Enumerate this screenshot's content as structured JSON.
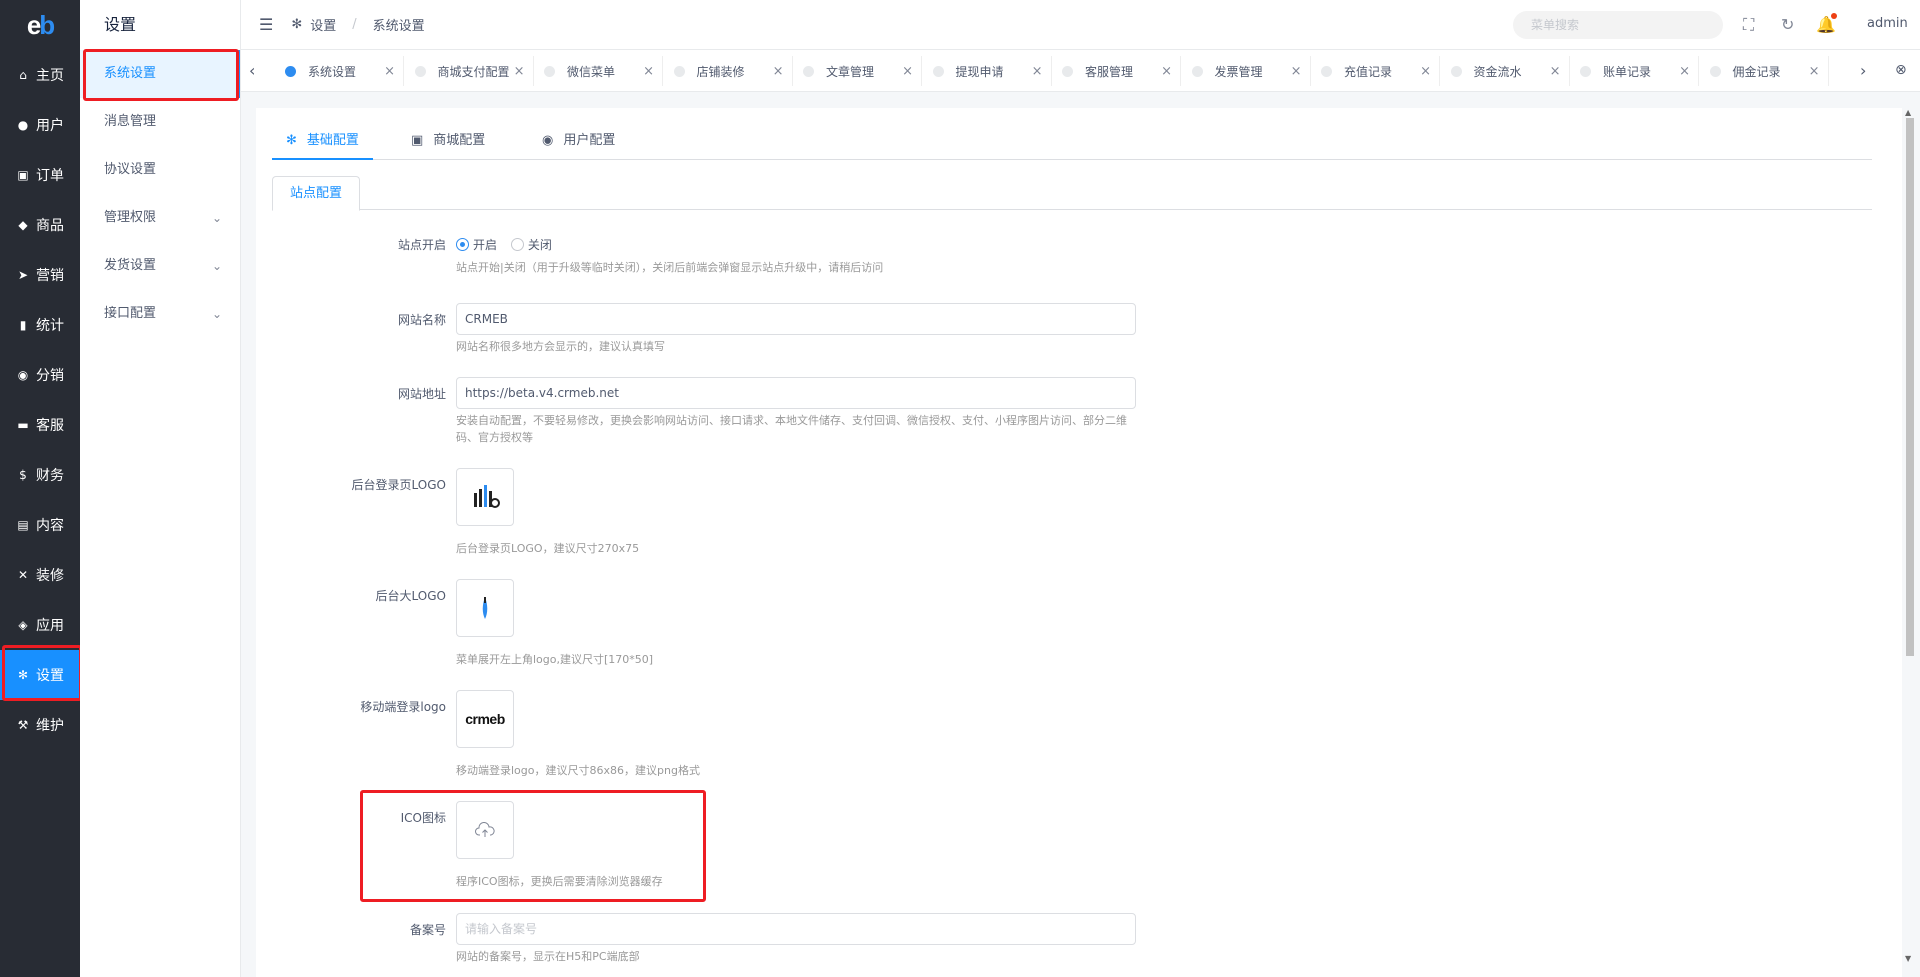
{
  "app": {
    "logo_e": "e",
    "logo_b": "b"
  },
  "rail": [
    {
      "label": "主页",
      "icon": "home-icon",
      "glyph": "⌂"
    },
    {
      "label": "用户",
      "icon": "user-icon",
      "glyph": "●"
    },
    {
      "label": "订单",
      "icon": "cart-icon",
      "glyph": "▣"
    },
    {
      "label": "商品",
      "icon": "bag-icon",
      "glyph": "◆"
    },
    {
      "label": "营销",
      "icon": "send-icon",
      "glyph": "➤"
    },
    {
      "label": "统计",
      "icon": "bar-chart-icon",
      "glyph": "▮"
    },
    {
      "label": "分销",
      "icon": "group-icon",
      "glyph": "◉"
    },
    {
      "label": "客服",
      "icon": "chat-icon",
      "glyph": "▬"
    },
    {
      "label": "财务",
      "icon": "dollar-icon",
      "glyph": "$"
    },
    {
      "label": "内容",
      "icon": "book-icon",
      "glyph": "▤"
    },
    {
      "label": "装修",
      "icon": "tools-icon",
      "glyph": "✕"
    },
    {
      "label": "应用",
      "icon": "cube-icon",
      "glyph": "◈"
    },
    {
      "label": "设置",
      "icon": "gear-icon",
      "glyph": "✻"
    },
    {
      "label": "维护",
      "icon": "hammer-icon",
      "glyph": "⚒"
    }
  ],
  "submenu": {
    "title": "设置",
    "items": [
      {
        "label": "系统设置",
        "chevron": false
      },
      {
        "label": "消息管理",
        "chevron": false
      },
      {
        "label": "协议设置",
        "chevron": false
      },
      {
        "label": "管理权限",
        "chevron": true
      },
      {
        "label": "发货设置",
        "chevron": true
      },
      {
        "label": "接口配置",
        "chevron": true
      }
    ]
  },
  "header": {
    "breadcrumb_1": "设置",
    "breadcrumb_sep": "/",
    "breadcrumb_2": "系统设置",
    "search_placeholder": "菜单搜索",
    "user": "admin"
  },
  "tabs": [
    "系统设置",
    "商城支付配置",
    "微信菜单",
    "店铺装修",
    "文章管理",
    "提现申请",
    "客服管理",
    "发票管理",
    "充值记录",
    "资金流水",
    "账单记录",
    "佣金记录"
  ],
  "content": {
    "tabs": [
      "基础配置",
      "商城配置",
      "用户配置"
    ],
    "subtab": "站点配置",
    "fields": {
      "site_open": {
        "label": "站点开启",
        "opt_on": "开启",
        "opt_off": "关闭",
        "help": "站点开始|关闭（用于升级等临时关闭），关闭后前端会弹窗显示站点升级中，请稍后访问"
      },
      "site_name": {
        "label": "网站名称",
        "value": "CRMEB",
        "help": "网站名称很多地方会显示的，建议认真填写"
      },
      "site_url": {
        "label": "网站地址",
        "value": "https://beta.v4.crmeb.net",
        "help": "安装自动配置，不要轻易修改，更换会影响网站访问、接口请求、本地文件储存、支付回调、微信授权、支付、小程序图片访问、部分二维码、官方授权等"
      },
      "login_logo": {
        "label": "后台登录页LOGO",
        "help": "后台登录页LOGO，建议尺寸270x75"
      },
      "big_logo": {
        "label": "后台大LOGO",
        "help": "菜单展开左上角logo,建议尺寸[170*50]"
      },
      "mobile_logo": {
        "label": "移动端登录logo",
        "help": "移动端登录logo，建议尺寸86x86，建议png格式",
        "img_text": "crmeb"
      },
      "ico": {
        "label": "ICO图标",
        "help": "程序ICO图标，更换后需要清除浏览器缓存"
      },
      "beian": {
        "label": "备案号",
        "placeholder": "请输入备案号",
        "help": "网站的备案号，显示在H5和PC端底部"
      }
    }
  },
  "colors": {
    "accent": "#1890ff",
    "rail_bg": "#282c34",
    "highlight": "#ee1d23"
  }
}
